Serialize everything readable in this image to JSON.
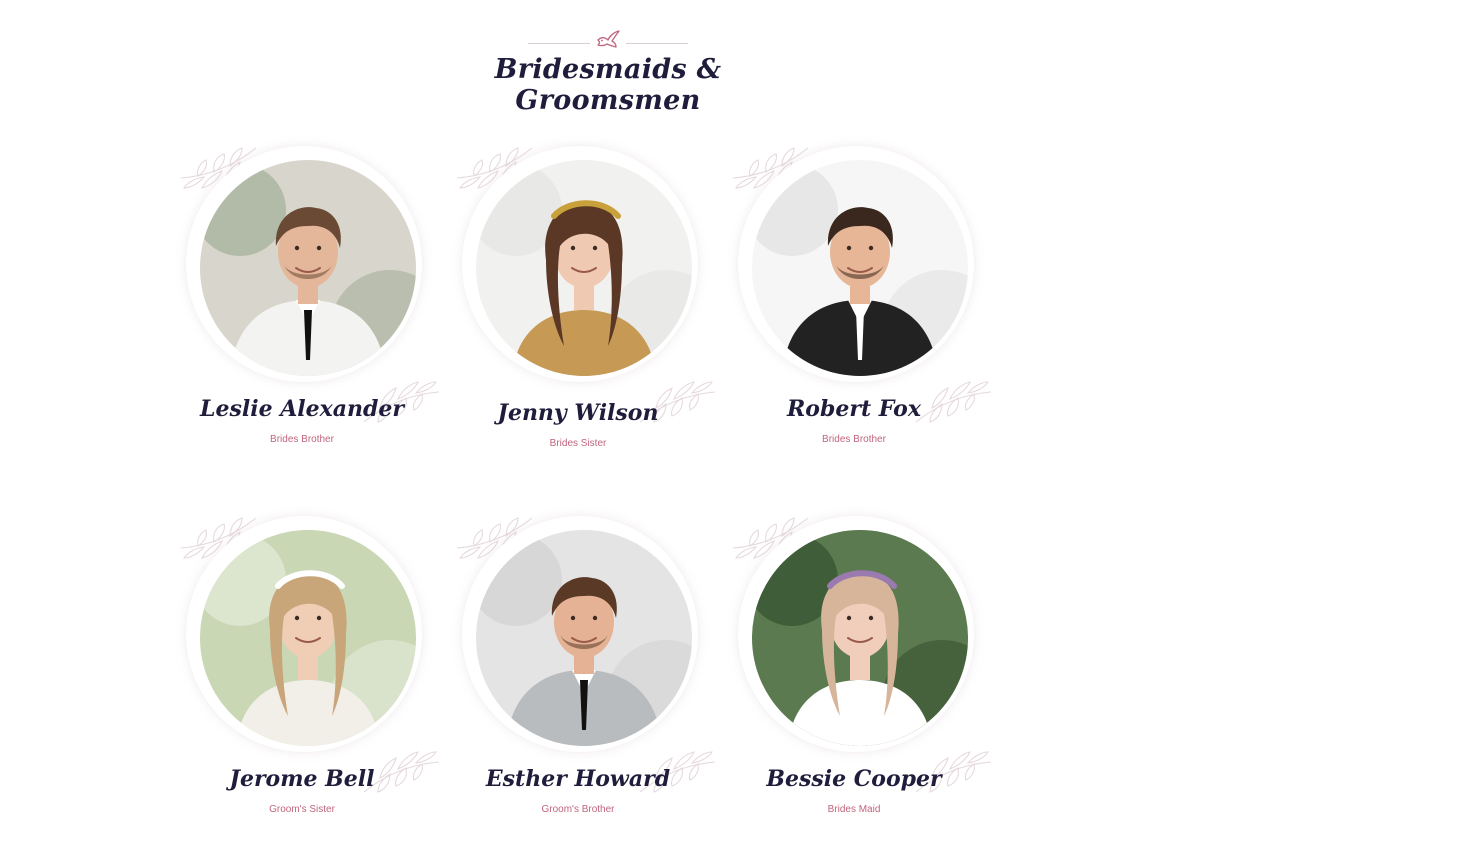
{
  "section": {
    "title": "Bridesmaids & Groomsmen",
    "ornament_icon": "dove-icon",
    "accent_color": "#c0657d",
    "title_color": "#1f1d3b"
  },
  "members": [
    {
      "name": "Leslie Alexander",
      "role": "Brides Brother",
      "photo_icon": "groom-portrait"
    },
    {
      "name": "Jenny Wilson",
      "role": "Brides Sister",
      "photo_icon": "bride-portrait"
    },
    {
      "name": "Robert Fox",
      "role": "Brides Brother",
      "photo_icon": "groom-portrait"
    },
    {
      "name": "Jerome Bell",
      "role": "Groom's Sister",
      "photo_icon": "bride-portrait"
    },
    {
      "name": "Esther Howard",
      "role": "Groom's Brother",
      "photo_icon": "groom-portrait"
    },
    {
      "name": "Bessie Cooper",
      "role": "Brides Maid",
      "photo_icon": "bride-portrait"
    }
  ]
}
